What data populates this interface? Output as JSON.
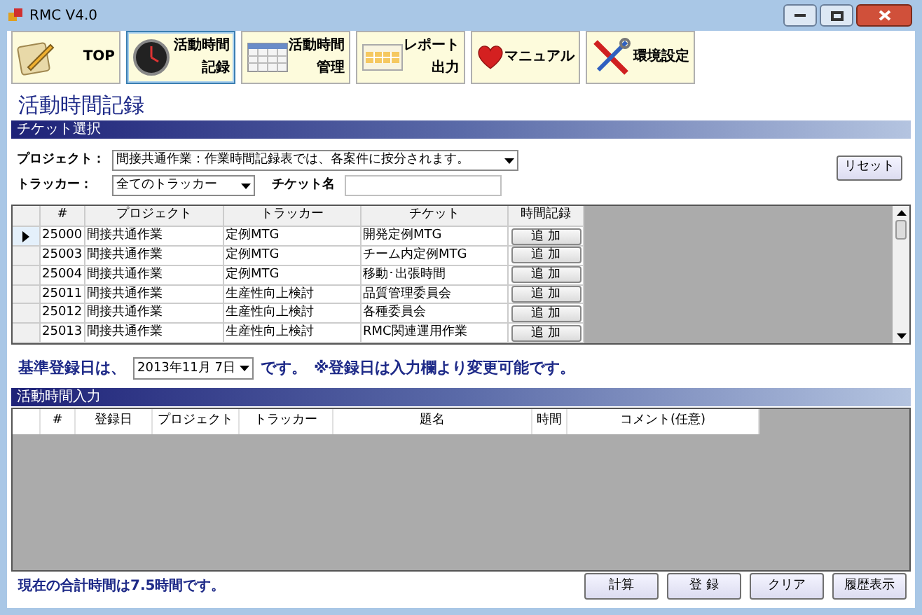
{
  "window": {
    "title": "RMC V4.0"
  },
  "toolbar": [
    {
      "kind": "notepad",
      "lines": [
        "TOP"
      ],
      "selected": false
    },
    {
      "kind": "clock",
      "lines": [
        "活動時間",
        "記録"
      ],
      "selected": true
    },
    {
      "kind": "calendar",
      "lines": [
        "活動時間",
        "管理"
      ],
      "selected": false
    },
    {
      "kind": "sheet",
      "lines": [
        "レポート",
        "出力"
      ],
      "selected": false
    },
    {
      "kind": "heart",
      "lines": [
        "マニュアル"
      ],
      "selected": false
    },
    {
      "kind": "tools",
      "lines": [
        "環境設定"
      ],
      "selected": false
    }
  ],
  "page_title": "活動時間記録",
  "ticket_section": {
    "title": "チケット選択",
    "project_label": "プロジェクト：",
    "project_value": "間接共通作業：作業時間記録表では、各案件に按分されます。",
    "tracker_label": "トラッカー：",
    "tracker_value": "全てのトラッカー",
    "ticket_label": "チケット名",
    "reset_button": "リセット"
  },
  "ticket_table": {
    "columns": [
      "#",
      "プロジェクト",
      "トラッカー",
      "チケット",
      "時間記録"
    ],
    "rows": [
      {
        "cells": [
          "25000",
          "間接共通作業",
          "定例MTG",
          "開発定例MTG"
        ],
        "action": "追 加",
        "selected": true
      },
      {
        "cells": [
          "25003",
          "間接共通作業",
          "定例MTG",
          "チーム内定例MTG"
        ],
        "action": "追 加",
        "selected": false
      },
      {
        "cells": [
          "25004",
          "間接共通作業",
          "定例MTG",
          "移動･出張時間"
        ],
        "action": "追 加",
        "selected": false
      },
      {
        "cells": [
          "25011",
          "間接共通作業",
          "生産性向上検討",
          "品質管理委員会"
        ],
        "action": "追 加",
        "selected": false
      },
      {
        "cells": [
          "25012",
          "間接共通作業",
          "生産性向上検討",
          "各種委員会"
        ],
        "action": "追 加",
        "selected": false
      },
      {
        "cells": [
          "25013",
          "間接共通作業",
          "生産性向上検討",
          "RMC関連運用作業"
        ],
        "action": "追 加",
        "selected": false
      }
    ]
  },
  "base_date": {
    "prefix": "基準登録日は、",
    "value": "2013年11月 7日",
    "suffix": "です。",
    "note": "※登録日は入力欄より変更可能です。"
  },
  "entry_section": {
    "title": "活動時間入力",
    "columns": [
      "#",
      "登録日",
      "プロジェクト",
      "トラッカー",
      "題名",
      "時間",
      "コメント(任意)"
    ]
  },
  "status": "現在の合計時間は7.5時間です。",
  "buttons": [
    "計算",
    "登 録",
    "クリア",
    "履歴表示"
  ]
}
